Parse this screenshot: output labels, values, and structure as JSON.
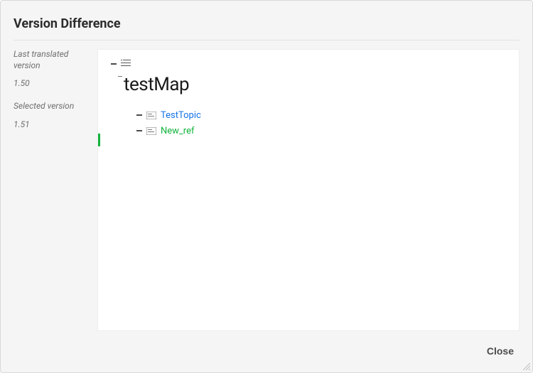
{
  "dialog": {
    "title": "Version Difference",
    "close_label": "Close"
  },
  "sidebar": {
    "last_translated_label": "Last translated version",
    "last_translated_value": "1.50",
    "selected_label": "Selected version",
    "selected_value": "1.51"
  },
  "tree": {
    "root_title": "testMap",
    "children": [
      {
        "label": "TestTopic",
        "status": "unchanged",
        "color": "#1473e6"
      },
      {
        "label": "New_ref",
        "status": "added",
        "color": "#12b33c"
      }
    ]
  }
}
